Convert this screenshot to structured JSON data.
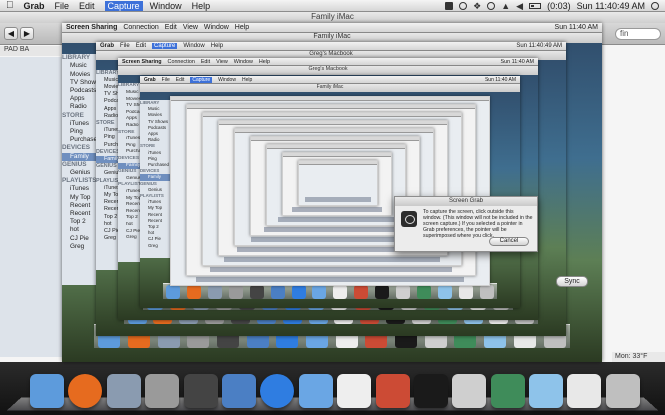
{
  "menubar": {
    "app_name": "Grab",
    "items": [
      "File",
      "Edit",
      "Capture",
      "Window",
      "Help"
    ],
    "active_item": "Capture",
    "status_time": "Sun 11:40:49 AM",
    "battery_pct": "(0:03)"
  },
  "outer_window": {
    "title": "Family iMac",
    "tab_label": "PAD BA",
    "search_placeholder": "fin"
  },
  "frames": [
    {
      "menu_app": "Screen Sharing",
      "menu_items": [
        "Connection",
        "Edit",
        "View",
        "Window",
        "Help"
      ],
      "time": "Sun 11:40 AM",
      "title": "Family iMac"
    },
    {
      "menu_app": "Grab",
      "menu_items": [
        "File",
        "Edit",
        "Capture",
        "Window",
        "Help"
      ],
      "active": "Capture",
      "time": "Sun 11:40:49 AM",
      "title": "Greg's Macbook"
    },
    {
      "menu_app": "Screen Sharing",
      "menu_items": [
        "Connection",
        "Edit",
        "View",
        "Window",
        "Help"
      ],
      "time": "Sun 11:40 AM",
      "title": "Greg's Macbook"
    },
    {
      "menu_app": "Grab",
      "menu_items": [
        "File",
        "Edit",
        "Capture",
        "Window",
        "Help"
      ],
      "active": "Capture",
      "time": "Sun 11:40 AM",
      "title": "Family iMac"
    }
  ],
  "sidebar": {
    "sections": [
      {
        "title": "LIBRARY",
        "items": [
          "Music",
          "Movies",
          "TV Shows",
          "Podcasts",
          "Apps",
          "Radio"
        ]
      },
      {
        "title": "STORE",
        "items": [
          "iTunes",
          "Ping",
          "Purchased"
        ]
      },
      {
        "title": "DEVICES",
        "items": [
          "Family"
        ]
      },
      {
        "title": "GENIUS",
        "items": [
          "Genius"
        ]
      },
      {
        "title": "PLAYLISTS",
        "items": [
          "iTunes",
          "My Top",
          "Recent",
          "Recent",
          "Top 2",
          "hot",
          "CJ Pie",
          "Greg"
        ]
      }
    ],
    "selected": "Family"
  },
  "dialog": {
    "title": "Screen Grab",
    "message": "To capture the screen, click outside this window. (This window will not be included in the screen capture.) If you selected a pointer in Grab preferences, the pointer will be superimposed where you click.",
    "button": "Cancel"
  },
  "sync_button": "Sync",
  "weather": "Mon: 33°F",
  "dock": {
    "icons": [
      {
        "name": "finder-icon",
        "color": "#5d9bdc"
      },
      {
        "name": "firefox-icon",
        "color": "#e66b1f"
      },
      {
        "name": "preview-icon",
        "color": "#8a9bb0"
      },
      {
        "name": "system-preferences-icon",
        "color": "#9a9a9a"
      },
      {
        "name": "dvd-player-icon",
        "color": "#444444"
      },
      {
        "name": "xcode-icon",
        "color": "#4b7fc4"
      },
      {
        "name": "itunes-icon",
        "color": "#2f7de1"
      },
      {
        "name": "keynote-icon",
        "color": "#6aa6e4"
      },
      {
        "name": "textedit-icon",
        "color": "#eeeeee"
      },
      {
        "name": "iphone-config-icon",
        "color": "#cc4b35"
      },
      {
        "name": "terminal-icon",
        "color": "#1a1a1a"
      },
      {
        "name": "grab-icon",
        "color": "#cfcfcf"
      },
      {
        "name": "screen-sharing-icon",
        "color": "#3f8c5a"
      },
      {
        "name": "documents-folder-icon",
        "color": "#8ec3ea"
      },
      {
        "name": "downloads-stack-icon",
        "color": "#e8e8e8"
      },
      {
        "name": "trash-icon",
        "color": "#bfbfbf"
      }
    ]
  }
}
